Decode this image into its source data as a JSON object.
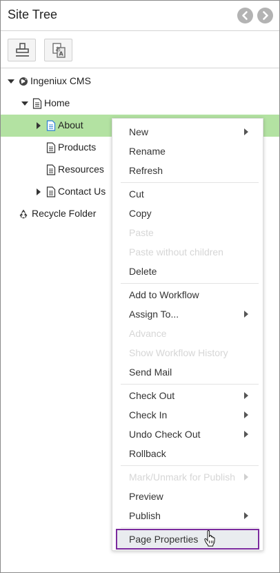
{
  "panel": {
    "title": "Site Tree",
    "nav_back_icon": "chevron-left-icon",
    "nav_forward_icon": "chevron-right-icon",
    "toolbar": {
      "buttons": [
        {
          "icon": "stamp-icon"
        },
        {
          "icon": "translate-icon"
        }
      ]
    }
  },
  "tree": {
    "nodes": [
      {
        "label": "Ingeniux CMS",
        "icon": "globe-icon",
        "expanded": true
      },
      {
        "label": "Home",
        "icon": "document-icon",
        "expanded": true
      },
      {
        "label": "About",
        "icon": "document-icon",
        "expanded": false,
        "selected": true
      },
      {
        "label": "Products",
        "icon": "document-icon"
      },
      {
        "label": "Resources",
        "icon": "document-icon"
      },
      {
        "label": "Contact Us",
        "icon": "document-icon",
        "expanded": false
      },
      {
        "label": "Recycle Folder",
        "icon": "recycle-icon"
      }
    ]
  },
  "context_menu": {
    "items": [
      {
        "label": "New",
        "submenu": true
      },
      {
        "label": "Rename"
      },
      {
        "label": "Refresh"
      },
      {
        "label": "Cut"
      },
      {
        "label": "Copy"
      },
      {
        "label": "Paste",
        "disabled": true
      },
      {
        "label": "Paste without children",
        "disabled": true
      },
      {
        "label": "Delete"
      },
      {
        "label": "Add to Workflow"
      },
      {
        "label": "Assign To...",
        "submenu": true
      },
      {
        "label": "Advance",
        "disabled": true
      },
      {
        "label": "Show Workflow History",
        "disabled": true
      },
      {
        "label": "Send Mail"
      },
      {
        "label": "Check Out",
        "submenu": true
      },
      {
        "label": "Check In",
        "submenu": true
      },
      {
        "label": "Undo Check Out",
        "submenu": true
      },
      {
        "label": "Rollback"
      },
      {
        "label": "Mark/Unmark for Publish",
        "submenu": true,
        "disabled": true
      },
      {
        "label": "Preview"
      },
      {
        "label": "Publish",
        "submenu": true
      },
      {
        "label": "Page Properties",
        "highlighted": true
      }
    ]
  },
  "colors": {
    "selected_row": "#b3e2a2",
    "highlight_outline": "#7b2a9e",
    "disabled_text": "#d6d6d6",
    "nav_button": "#b3b3b3"
  },
  "cursor": "hand-pointer-icon"
}
